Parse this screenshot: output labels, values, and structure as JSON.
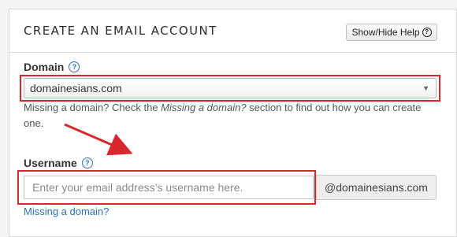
{
  "panel": {
    "title": "CREATE AN EMAIL ACCOUNT",
    "help_button_label": "Show/Hide Help",
    "help_button_icon": "question-circle-icon"
  },
  "domain": {
    "label": "Domain",
    "help_icon": "question-circle-icon",
    "selected": "domainesians.com",
    "hint_before": "Missing a domain? Check the ",
    "hint_emphasis": "Missing a domain?",
    "hint_after": " section to find out how you can create one."
  },
  "username": {
    "label": "Username",
    "help_icon": "question-circle-icon",
    "placeholder": "Enter your email address’s username here.",
    "value": "",
    "domain_suffix": "@domainesians.com",
    "missing_link": "Missing a domain?"
  },
  "colors": {
    "highlight": "#d9272e",
    "link": "#2a73b8"
  }
}
